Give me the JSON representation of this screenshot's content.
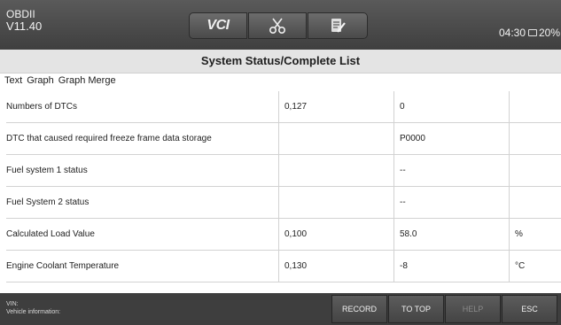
{
  "header": {
    "app_name": "OBDII",
    "version": "V11.40",
    "vci_label": "VCI",
    "time": "04:30",
    "battery": "20%",
    "icons": [
      "vci-icon",
      "scissors-icon",
      "report-icon",
      "battery-icon"
    ]
  },
  "title": "System Status/Complete List",
  "tabs": [
    "Text",
    "Graph",
    "Graph Merge"
  ],
  "table": {
    "rows": [
      {
        "name": "Numbers of DTCs",
        "pid": "0,127",
        "value": "0",
        "unit": ""
      },
      {
        "name": "DTC that caused required freeze frame data storage",
        "pid": "",
        "value": "P0000",
        "unit": ""
      },
      {
        "name": "Fuel system 1 status",
        "pid": "",
        "value": "--",
        "unit": ""
      },
      {
        "name": "Fuel System 2 status",
        "pid": "",
        "value": "--",
        "unit": ""
      },
      {
        "name": "Calculated Load Value",
        "pid": "0,100",
        "value": "58.0",
        "unit": "%"
      },
      {
        "name": "Engine Coolant Temperature",
        "pid": "0,130",
        "value": "-8",
        "unit": "°C"
      }
    ]
  },
  "footer": {
    "vin_label": "VIN:",
    "vehicle_info_label": "Vehicle information:",
    "buttons": {
      "record": "RECORD",
      "to_top": "TO TOP",
      "help": "HELP",
      "esc": "ESC"
    }
  }
}
